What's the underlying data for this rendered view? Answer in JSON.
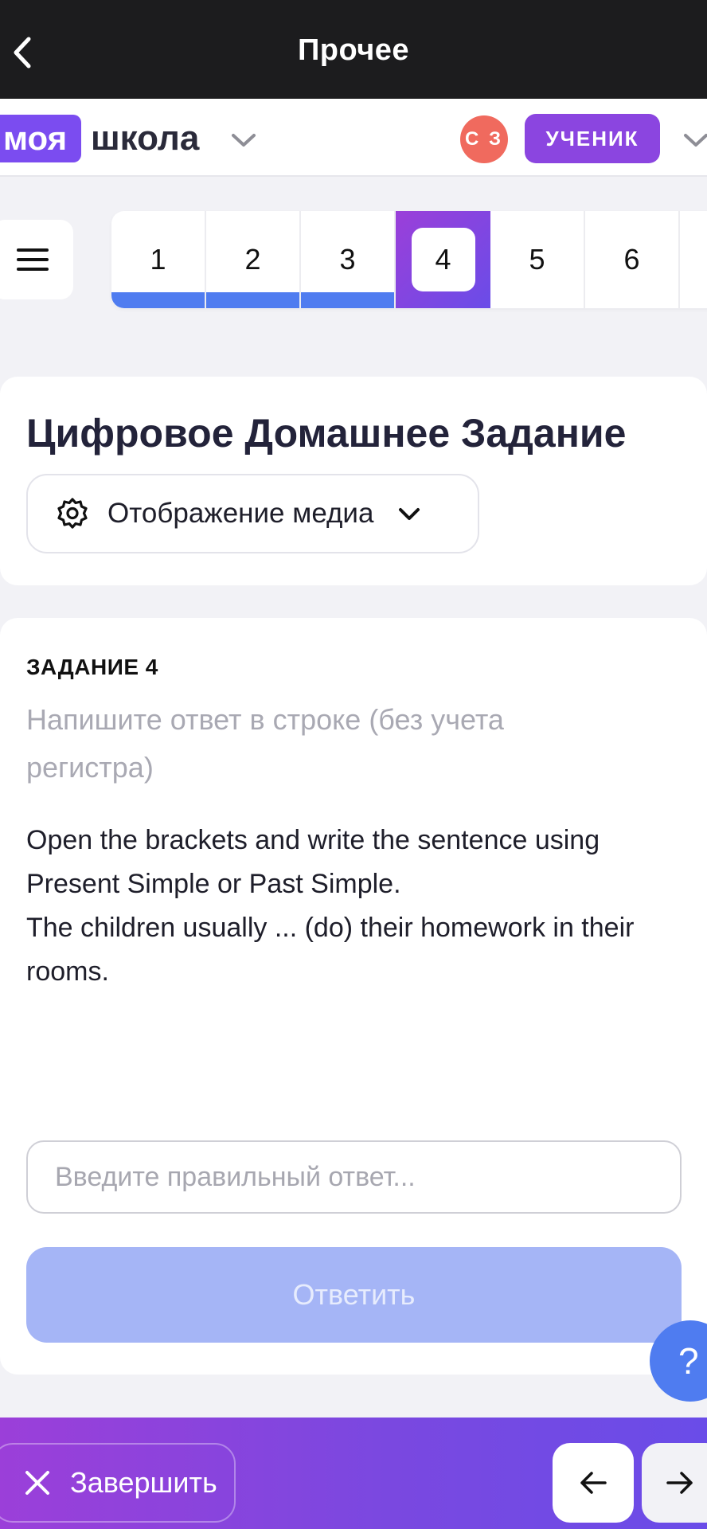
{
  "topbar": {
    "title": "Прочее"
  },
  "brand": {
    "logo_part1": "моя",
    "logo_part2": "школа"
  },
  "user": {
    "initials": "С З",
    "role": "УЧЕНИК"
  },
  "progress": {
    "tabs": [
      {
        "label": "1",
        "state": "done"
      },
      {
        "label": "2",
        "state": "done"
      },
      {
        "label": "3",
        "state": "done"
      },
      {
        "label": "4",
        "state": "active"
      },
      {
        "label": "5",
        "state": "pending"
      },
      {
        "label": "6",
        "state": "pending"
      }
    ]
  },
  "header": {
    "title": "Цифровое Домашнее Задание",
    "media_label": "Отображение медиа"
  },
  "task": {
    "label": "ЗАДАНИЕ 4",
    "hint": "Напишите ответ в строке (без учета регистра)",
    "line1": "Open the brackets and write the sentence using Present Simple or Past Simple.",
    "line2": "The children usually ... (do) their homework in their rooms.",
    "answer_value": "",
    "answer_placeholder": "Введите правильный ответ...",
    "submit_label": "Ответить"
  },
  "help": {
    "label": "?"
  },
  "footer": {
    "finish_label": "Завершить"
  },
  "colors": {
    "accent": "#7b4cf0",
    "progress": "#4f7cf0",
    "avatar": "#f06a5e",
    "submit_disabled": "#a5b5f6"
  },
  "icons": [
    "back-chevron-icon",
    "chevron-down-icon",
    "hamburger-icon",
    "gear-icon",
    "close-icon",
    "arrow-left-icon",
    "arrow-right-icon"
  ]
}
